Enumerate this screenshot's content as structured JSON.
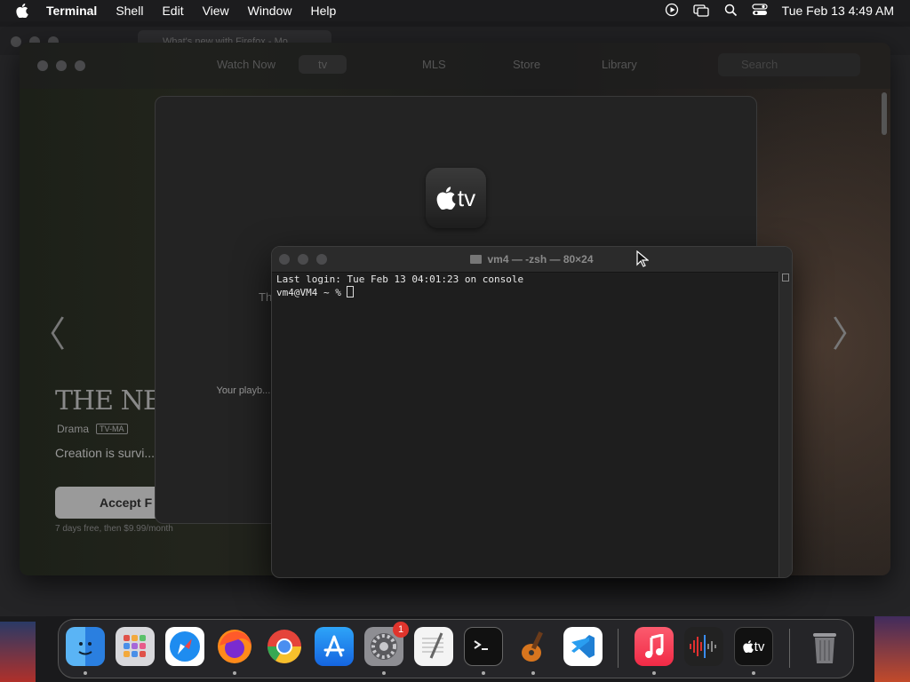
{
  "menubar": {
    "app_name": "Terminal",
    "items": [
      "Shell",
      "Edit",
      "View",
      "Window",
      "Help"
    ],
    "clock": "Tue Feb 13  4:49 AM"
  },
  "browser": {
    "tab_title": "What's new with Firefox - Mo..."
  },
  "tv_app": {
    "nav": [
      "Watch Now",
      "tv",
      "MLS",
      "Store",
      "Library"
    ],
    "search_placeholder": "Search",
    "show_title": "THE NE",
    "genre": "Drama",
    "rating": "TV-MA",
    "description": "Creation is survi... legends. New se...",
    "accept_button": "Accept F",
    "price_note": "7 days free, then $9.99/month"
  },
  "tv_modal": {
    "logo_text": "tv",
    "heading": "Th",
    "privacy_text": "Your playb... improve"
  },
  "terminal": {
    "title": "vm4 — -zsh — 80×24",
    "lines": [
      "Last login: Tue Feb 13 04:01:23 on console",
      "vm4@VM4 ~ % "
    ]
  },
  "dock": {
    "apps": [
      {
        "name": "Finder",
        "icon": "finder-icon",
        "running": true
      },
      {
        "name": "Launchpad",
        "icon": "launchpad-icon",
        "running": false
      },
      {
        "name": "Safari",
        "icon": "safari-icon",
        "running": false
      },
      {
        "name": "Firefox",
        "icon": "firefox-icon",
        "running": true
      },
      {
        "name": "Google Chrome",
        "icon": "chrome-icon",
        "running": false
      },
      {
        "name": "App Store",
        "icon": "app-store-icon",
        "running": false
      },
      {
        "name": "System Settings",
        "icon": "settings-icon",
        "running": true,
        "badge": "1"
      },
      {
        "name": "TextEdit",
        "icon": "textedit-icon",
        "running": false
      },
      {
        "name": "Terminal",
        "icon": "terminal-icon",
        "running": true
      },
      {
        "name": "GarageBand",
        "icon": "garageband-icon",
        "running": true
      },
      {
        "name": "Visual Studio Code",
        "icon": "vscode-icon",
        "running": false
      },
      {
        "name": "Music",
        "icon": "music-icon",
        "running": true
      },
      {
        "name": "Voice Memos",
        "icon": "voice-memos-icon",
        "running": false
      },
      {
        "name": "Apple TV",
        "icon": "apple-tv-icon",
        "running": true
      },
      {
        "name": "Trash",
        "icon": "trash-icon",
        "running": false
      }
    ]
  }
}
